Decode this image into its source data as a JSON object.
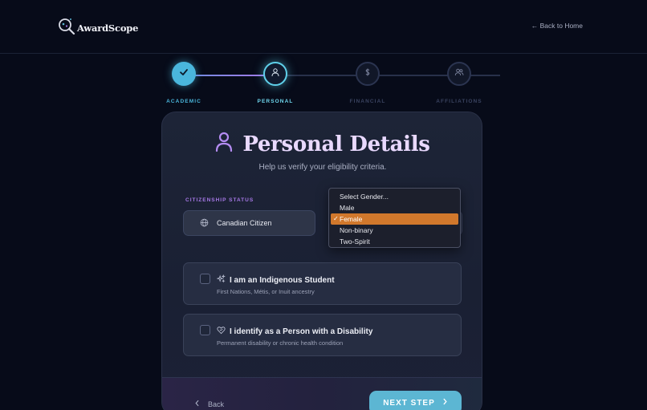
{
  "header": {
    "logo_text": "AwardScope",
    "back_link": "← Back to Home"
  },
  "stepper": {
    "steps": [
      {
        "label": "ACADEMIC",
        "state": "complete",
        "icon": "check-icon"
      },
      {
        "label": "PERSONAL",
        "state": "active",
        "icon": "user-icon"
      },
      {
        "label": "FINANCIAL",
        "state": "upcoming",
        "icon": "dollar-icon"
      },
      {
        "label": "AFFILIATIONS",
        "state": "upcoming",
        "icon": "users-icon"
      }
    ]
  },
  "card": {
    "title": "Personal Details",
    "title_icon": "user-icon",
    "subtitle": "Help us verify your eligibility criteria.",
    "citizenship": {
      "label": "CITIZENSHIP STATUS",
      "value": "Canadian Citizen",
      "icon": "globe-icon"
    },
    "gender_dropdown": {
      "options": [
        "Select Gender...",
        "Male",
        "Female",
        "Non-binary",
        "Two-Spirit"
      ],
      "selected": "Female",
      "check_mark": "✓",
      "highlight_color": "#d1782c"
    },
    "checks": [
      {
        "title": "I am an Indigenous Student",
        "subtitle": "First Nations, Métis, or Inuit ancestry",
        "icon": "sparkles-icon",
        "checked": false
      },
      {
        "title": "I identify as a Person with a Disability",
        "subtitle": "Permanent disability or chronic health condition",
        "icon": "heart-handshake-icon",
        "checked": false
      }
    ],
    "back_label": "Back",
    "next_label": "NEXT STEP"
  },
  "colors": {
    "background": "#070b19",
    "accent_cyan": "#5cb6d3",
    "accent_purple": "#a678e6"
  }
}
